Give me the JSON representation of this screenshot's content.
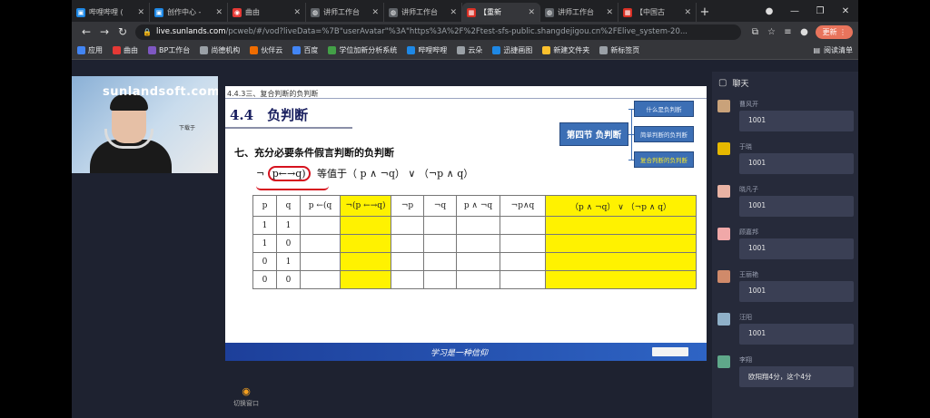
{
  "tabs": [
    {
      "label": "哔哩哔哩 (",
      "color": "#1e88e5",
      "glyph": "▣",
      "active": false
    },
    {
      "label": "创作中心 -",
      "color": "#1e88e5",
      "glyph": "▣",
      "active": false
    },
    {
      "label": "曲由",
      "color": "#e53935",
      "glyph": "◉",
      "active": false
    },
    {
      "label": "讲师工作台",
      "color": "#5f6368",
      "glyph": "◍",
      "active": false
    },
    {
      "label": "讲师工作台",
      "color": "#5f6368",
      "glyph": "◍",
      "active": false
    },
    {
      "label": "【重新",
      "color": "#d93025",
      "glyph": "▦",
      "active": true
    },
    {
      "label": "讲师工作台",
      "color": "#5f6368",
      "glyph": "◍",
      "active": false
    },
    {
      "label": "【中国古",
      "color": "#d93025",
      "glyph": "▦",
      "active": false
    }
  ],
  "address": {
    "host": "live.sunlands.com",
    "path": "/pcweb/#/vod?liveData=%7B\"userAvatar\"%3A\"https%3A%2F%2Ftest-sfs-public.shangdejigou.cn%2FElive_system-20..."
  },
  "update_label": "更新",
  "bookmarks": [
    {
      "label": "应用",
      "color": "#4285f4"
    },
    {
      "label": "曲由",
      "color": "#e53935"
    },
    {
      "label": "BP工作台",
      "color": "#7e57c2"
    },
    {
      "label": "尚德机构",
      "color": "#9aa0a6"
    },
    {
      "label": "伙伴云",
      "color": "#ef6c00"
    },
    {
      "label": "百度",
      "color": "#4285f4"
    },
    {
      "label": "学位加新分析系统",
      "color": "#43a047"
    },
    {
      "label": "哔哩哔哩",
      "color": "#1e88e5"
    },
    {
      "label": "云朵",
      "color": "#9aa0a6"
    },
    {
      "label": "迅捷画图",
      "color": "#1e88e5"
    },
    {
      "label": "新建文件夹",
      "color": "#fbc02d"
    },
    {
      "label": "新标签页",
      "color": "#9aa0a6"
    }
  ],
  "reading_list": "阅读清单",
  "webcam": {
    "logo": "sunlandsoft.com",
    "sub": "下载于"
  },
  "slide": {
    "section": "4.4.3三、复合判断的负判断",
    "heading": "4.4　负判断",
    "subtitle": "七、充分必要条件假言判断的负判断",
    "formula_neg": "¬",
    "formula_circled": "p←→q)",
    "formula_rest": "等值于（ p ∧ ¬q） ∨ （¬p ∧ q）",
    "mindmap": {
      "root": "第四节 负判断",
      "nodes": [
        "什么是负判断",
        "简单判断的负判断",
        "复合判断的负判断"
      ]
    },
    "table": {
      "headers": [
        "p",
        "q",
        "p ←(q",
        "¬(p ←→q)",
        "¬p",
        "¬q",
        "p ∧ ¬q",
        "¬p∧q",
        "（p ∧ ¬q） ∨ （¬p ∧ q）"
      ],
      "rows": [
        [
          "1",
          "1",
          "",
          "",
          "",
          "",
          "",
          "",
          ""
        ],
        [
          "1",
          "0",
          "",
          "",
          "",
          "",
          "",
          "",
          ""
        ],
        [
          "0",
          "1",
          "",
          "",
          "",
          "",
          "",
          "",
          ""
        ],
        [
          "0",
          "0",
          "",
          "",
          "",
          "",
          "",
          "",
          ""
        ]
      ]
    },
    "footer_motto": "学习是一种信仰"
  },
  "window_switch_label": "切换窗口",
  "chat": {
    "title": "聊天",
    "messages": [
      {
        "user": "曹风开",
        "text": "1001",
        "avatar_color": "#c9a27a"
      },
      {
        "user": "于晓",
        "text": "1001",
        "avatar_color": "#e6b800"
      },
      {
        "user": "晓凡子",
        "text": "1001",
        "avatar_color": "#e9b3a4"
      },
      {
        "user": "顾嘉邦",
        "text": "1001",
        "avatar_color": "#f0a8a8"
      },
      {
        "user": "王丽艳",
        "text": "1001",
        "avatar_color": "#d08a6a"
      },
      {
        "user": "汪阳",
        "text": "1001",
        "avatar_color": "#8fb0c8"
      },
      {
        "user": "李翔",
        "text": "欧阳翔4分，这个4分",
        "avatar_color": "#5fa88a"
      }
    ]
  }
}
